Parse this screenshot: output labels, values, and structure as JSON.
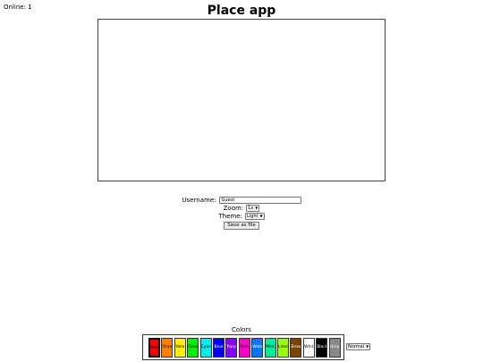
{
  "online_label": "Online: 1",
  "title": "Place app",
  "controls": {
    "username_label": "Username:",
    "username_value": "Guest",
    "zoom_label": "Zoom:",
    "zoom_value": "1x",
    "theme_label": "Theme:",
    "theme_value": "Light",
    "save_label": "Save as file"
  },
  "palette": {
    "title": "Colors",
    "mode_value": "Normal",
    "selected": "Red",
    "colors": [
      {
        "name": "Red",
        "label": "Red",
        "hex": "#ff0000",
        "text": "#000000"
      },
      {
        "name": "Orange",
        "label": "Oran",
        "hex": "#ff8000",
        "text": "#000000"
      },
      {
        "name": "Yellow",
        "label": "Yello",
        "hex": "#ffee00",
        "text": "#000000"
      },
      {
        "name": "Green",
        "label": "Gree",
        "hex": "#00ee00",
        "text": "#000000"
      },
      {
        "name": "Cyan",
        "label": "Cyan",
        "hex": "#00eeee",
        "text": "#000000"
      },
      {
        "name": "Blue",
        "label": "Blue",
        "hex": "#0000ff",
        "text": "#ffffff"
      },
      {
        "name": "Purple",
        "label": "Purp",
        "hex": "#8800ff",
        "text": "#ffffff"
      },
      {
        "name": "Pink",
        "label": "Pink",
        "hex": "#ff00cc",
        "text": "#000000"
      },
      {
        "name": "Water",
        "label": "Wate",
        "hex": "#0077ff",
        "text": "#ffffff"
      },
      {
        "name": "Mint",
        "label": "Mint",
        "hex": "#00ee99",
        "text": "#000000"
      },
      {
        "name": "Lime",
        "label": "Lime",
        "hex": "#99ff00",
        "text": "#000000"
      },
      {
        "name": "Brown",
        "label": "Brow",
        "hex": "#7a4400",
        "text": "#ffffff"
      },
      {
        "name": "White",
        "label": "Whit",
        "hex": "#ffffff",
        "text": "#000000"
      },
      {
        "name": "Black",
        "label": "Black",
        "hex": "#000000",
        "text": "#ffffff"
      },
      {
        "name": "Gray",
        "label": "Gray",
        "hex": "#888888",
        "text": "#ffffff"
      }
    ]
  }
}
